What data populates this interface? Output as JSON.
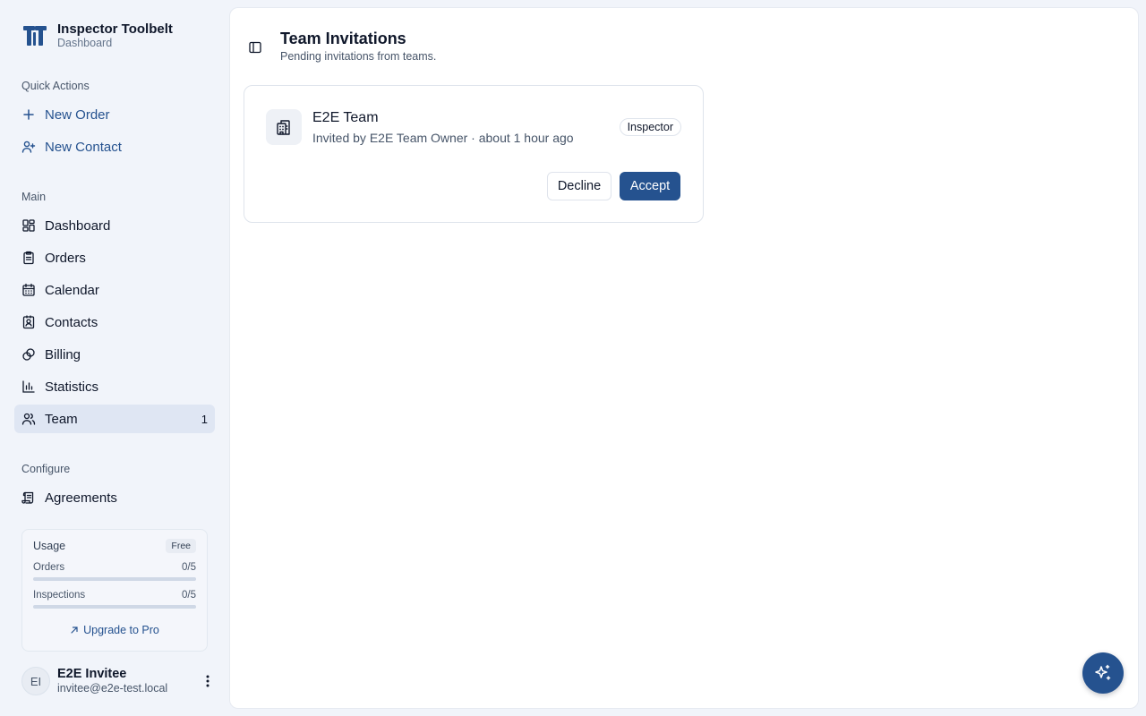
{
  "brand": {
    "name": "Inspector Toolbelt",
    "subtitle": "Dashboard",
    "icon": "toolbelt-logo-icon"
  },
  "quick_actions": {
    "label": "Quick Actions",
    "items": [
      {
        "label": "New Order",
        "icon": "plus-icon"
      },
      {
        "label": "New Contact",
        "icon": "user-plus-icon"
      }
    ]
  },
  "main_nav": {
    "label": "Main",
    "items": [
      {
        "label": "Dashboard",
        "icon": "layout-grid-icon"
      },
      {
        "label": "Orders",
        "icon": "clipboard-icon"
      },
      {
        "label": "Calendar",
        "icon": "calendar-icon"
      },
      {
        "label": "Contacts",
        "icon": "contact-card-icon"
      },
      {
        "label": "Billing",
        "icon": "coins-icon"
      },
      {
        "label": "Statistics",
        "icon": "bar-chart-icon"
      },
      {
        "label": "Team",
        "icon": "users-icon",
        "badge": "1",
        "active": true
      }
    ]
  },
  "configure_nav": {
    "label": "Configure",
    "items": [
      {
        "label": "Agreements",
        "icon": "scroll-icon"
      }
    ]
  },
  "usage": {
    "title": "Usage",
    "plan": "Free",
    "meters": [
      {
        "label": "Orders",
        "value": "0/5",
        "fraction": 0
      },
      {
        "label": "Inspections",
        "value": "0/5",
        "fraction": 0
      }
    ],
    "upgrade_label": "Upgrade to Pro"
  },
  "user": {
    "initials": "EI",
    "name": "E2E Invitee",
    "email": "invitee@e2e-test.local"
  },
  "page": {
    "title": "Team Invitations",
    "subtitle": "Pending invitations from teams."
  },
  "invitation": {
    "team_name": "E2E Team",
    "meta": "Invited by E2E Team Owner · about 1 hour ago",
    "role": "Inspector",
    "decline_label": "Decline",
    "accept_label": "Accept"
  },
  "colors": {
    "accent": "#25528f",
    "active_bg": "#dfe6f3",
    "app_bg": "#f1f4fa"
  }
}
